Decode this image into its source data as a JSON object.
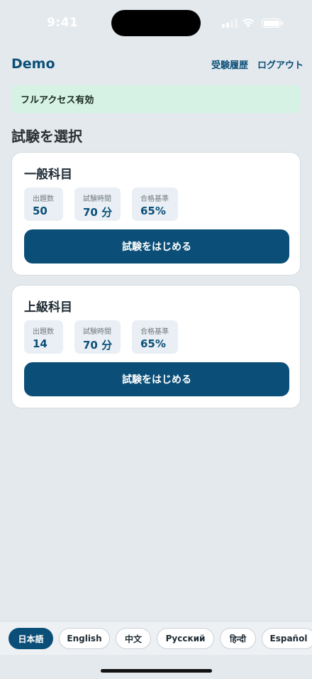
{
  "status_bar": {
    "time": "9:41",
    "icons": [
      "cellular-signal-icon",
      "wifi-icon",
      "battery-icon"
    ]
  },
  "header": {
    "brand": "Demo",
    "history_link": "受験履歴",
    "logout_link": "ログアウト"
  },
  "access_banner": "フルアクセス有効",
  "section_title": "試験を選択",
  "exams": [
    {
      "title": "一般科目",
      "stats": [
        {
          "label": "出題数",
          "value": "50"
        },
        {
          "label": "試験時間",
          "value": "70 分"
        },
        {
          "label": "合格基準",
          "value": "65%"
        }
      ],
      "button": "試験をはじめる"
    },
    {
      "title": "上級科目",
      "stats": [
        {
          "label": "出題数",
          "value": "14"
        },
        {
          "label": "試験時間",
          "value": "70 分"
        },
        {
          "label": "合格基準",
          "value": "65%"
        }
      ],
      "button": "試験をはじめる"
    }
  ],
  "languages": [
    "日本語",
    "English",
    "中文",
    "Русский",
    "हिन्दी",
    "Español"
  ],
  "active_language": "日本語",
  "colors": {
    "primary": "#0b4f78",
    "background": "#e4e9ed",
    "banner": "#d6f2e4",
    "stat_background": "#e9eff4"
  }
}
